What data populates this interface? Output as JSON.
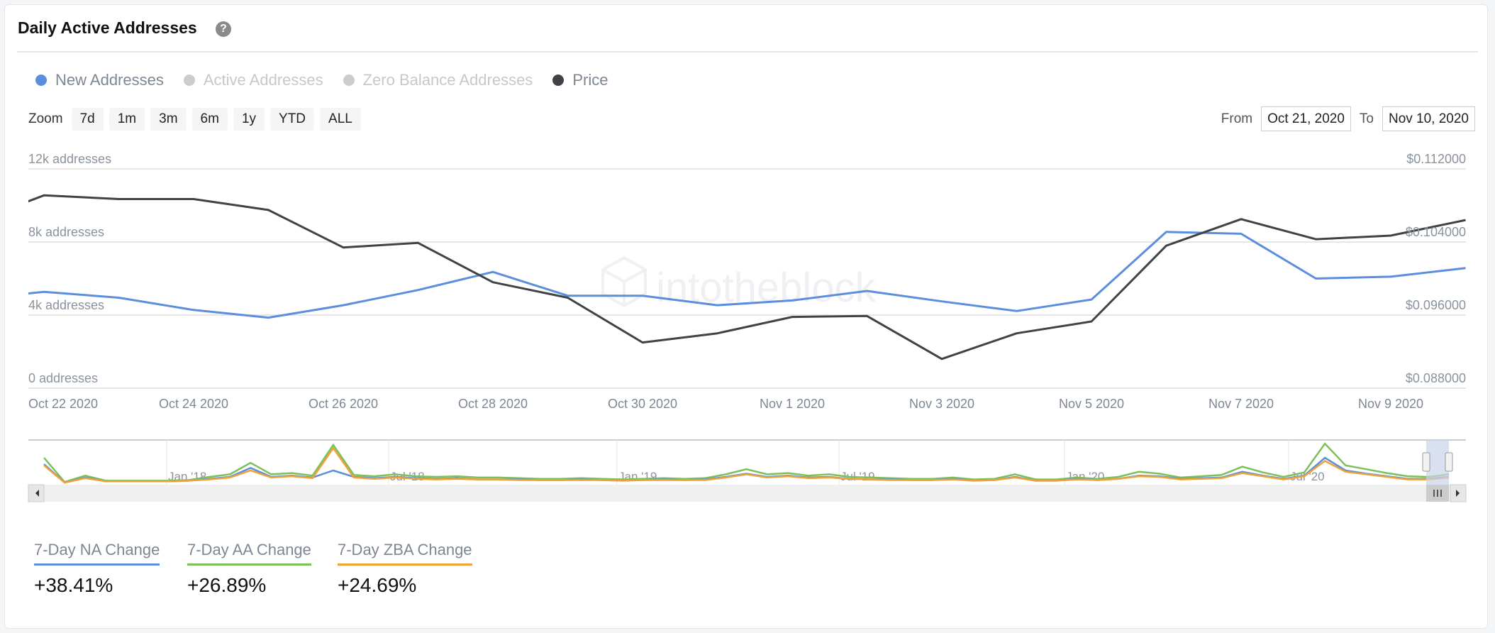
{
  "header": {
    "title": "Daily Active Addresses",
    "help_icon": "question-circle-icon"
  },
  "legend": [
    {
      "label": "New Addresses",
      "color": "#5b8fde",
      "active": true
    },
    {
      "label": "Active Addresses",
      "color": "#cccccc",
      "active": false
    },
    {
      "label": "Zero Balance Addresses",
      "color": "#cccccc",
      "active": false
    },
    {
      "label": "Price",
      "color": "#3f4246",
      "active": true
    }
  ],
  "zoom": {
    "label": "Zoom",
    "buttons": [
      "7d",
      "1m",
      "3m",
      "6m",
      "1y",
      "YTD",
      "ALL"
    ]
  },
  "range": {
    "from_label": "From",
    "from_value": "Oct 21, 2020",
    "to_label": "To",
    "to_value": "Nov 10, 2020"
  },
  "watermark": "intotheblock",
  "chart_data": {
    "type": "line",
    "x": [
      "Oct 21 2020",
      "Oct 22 2020",
      "Oct 23 2020",
      "Oct 24 2020",
      "Oct 25 2020",
      "Oct 26 2020",
      "Oct 27 2020",
      "Oct 28 2020",
      "Oct 29 2020",
      "Oct 30 2020",
      "Oct 31 2020",
      "Nov 1 2020",
      "Nov 2 2020",
      "Nov 3 2020",
      "Nov 4 2020",
      "Nov 5 2020",
      "Nov 6 2020",
      "Nov 7 2020",
      "Nov 8 2020",
      "Nov 9 2020",
      "Nov 10 2020"
    ],
    "x_tick_labels": [
      {
        "i": 1,
        "label": "Oct 22 2020"
      },
      {
        "i": 3,
        "label": "Oct 24 2020"
      },
      {
        "i": 5,
        "label": "Oct 26 2020"
      },
      {
        "i": 7,
        "label": "Oct 28 2020"
      },
      {
        "i": 9,
        "label": "Oct 30 2020"
      },
      {
        "i": 11,
        "label": "Nov 1 2020"
      },
      {
        "i": 13,
        "label": "Nov 3 2020"
      },
      {
        "i": 15,
        "label": "Nov 5 2020"
      },
      {
        "i": 17,
        "label": "Nov 7 2020"
      },
      {
        "i": 19,
        "label": "Nov 9 2020"
      }
    ],
    "y_left": {
      "ylim": [
        0,
        12000
      ],
      "ticks": [
        {
          "v": 12000,
          "label": "12k addresses"
        },
        {
          "v": 8000,
          "label": "8k addresses"
        },
        {
          "v": 4000,
          "label": "4k addresses"
        },
        {
          "v": 0,
          "label": "0 addresses"
        }
      ]
    },
    "y_right": {
      "ylim": [
        0.088,
        0.112
      ],
      "ticks": [
        {
          "v": 0.112,
          "label": "$0.112000"
        },
        {
          "v": 0.104,
          "label": "$0.104000"
        },
        {
          "v": 0.096,
          "label": "$0.096000"
        },
        {
          "v": 0.088,
          "label": "$0.088000"
        }
      ]
    },
    "grid": true,
    "series": [
      {
        "name": "New Addresses",
        "axis": "left",
        "color": "#5b8fde",
        "values": [
          4850,
          5270,
          4950,
          4280,
          3860,
          4540,
          5370,
          6360,
          5060,
          5060,
          4540,
          4800,
          5320,
          4750,
          4220,
          4850,
          8550,
          8450,
          6000,
          6100,
          6570
        ]
      },
      {
        "name": "Price",
        "axis": "right",
        "color": "#3f4246",
        "values": [
          0.106,
          0.1091,
          0.1087,
          0.1087,
          0.1075,
          0.1034,
          0.1039,
          0.0996,
          0.0979,
          0.093,
          0.094,
          0.0958,
          0.0959,
          0.0912,
          0.094,
          0.0953,
          0.1036,
          0.1065,
          0.1043,
          0.1047,
          0.1064
        ]
      }
    ],
    "navigator": {
      "tick_labels": [
        "Jan '18",
        "Jul '18",
        "Jan '19",
        "Jul '19",
        "Jan '20",
        "Jul '20"
      ],
      "series": [
        {
          "name": "Active Addresses",
          "color": "#7cc05a",
          "values": [
            40,
            2,
            12,
            4,
            4,
            4,
            4,
            5,
            10,
            14,
            32,
            14,
            16,
            12,
            60,
            13,
            11,
            14,
            11,
            10,
            11,
            9,
            9,
            8,
            7,
            7,
            8,
            7,
            6,
            7,
            8,
            7,
            8,
            14,
            22,
            14,
            16,
            12,
            14,
            10,
            9,
            8,
            7,
            7,
            9,
            6,
            7,
            14,
            6,
            6,
            9,
            7,
            10,
            18,
            15,
            9,
            11,
            13,
            26,
            17,
            10,
            17,
            62,
            28,
            22,
            16,
            11,
            10,
            14
          ]
        },
        {
          "name": "New Addresses",
          "color": "#5b8fde",
          "values": [
            30,
            1,
            9,
            3,
            3,
            3,
            3,
            4,
            7,
            10,
            24,
            10,
            12,
            9,
            20,
            10,
            8,
            10,
            8,
            7,
            8,
            6,
            6,
            6,
            5,
            5,
            6,
            5,
            4,
            5,
            6,
            5,
            6,
            10,
            15,
            10,
            12,
            9,
            10,
            7,
            6,
            6,
            5,
            5,
            7,
            4,
            5,
            10,
            4,
            4,
            7,
            5,
            7,
            12,
            11,
            7,
            8,
            9,
            18,
            12,
            7,
            12,
            40,
            20,
            15,
            11,
            7,
            7,
            10
          ]
        },
        {
          "name": "Zero Balance Addresses",
          "color": "#f0a23a",
          "values": [
            28,
            1,
            8,
            3,
            3,
            3,
            3,
            4,
            6,
            9,
            20,
            9,
            11,
            8,
            55,
            9,
            7,
            9,
            7,
            6,
            7,
            6,
            6,
            5,
            5,
            5,
            5,
            5,
            4,
            5,
            5,
            5,
            5,
            9,
            14,
            9,
            11,
            8,
            9,
            7,
            6,
            5,
            5,
            5,
            6,
            4,
            5,
            9,
            4,
            4,
            6,
            5,
            7,
            11,
            10,
            6,
            7,
            8,
            16,
            11,
            6,
            11,
            35,
            18,
            14,
            10,
            6,
            6,
            9
          ]
        }
      ]
    }
  },
  "stats": [
    {
      "label": "7-Day NA Change",
      "value": "+38.41%",
      "color": "#5b8fde"
    },
    {
      "label": "7-Day AA Change",
      "value": "+26.89%",
      "color": "#7cc05a"
    },
    {
      "label": "7-Day ZBA Change",
      "value": "+24.69%",
      "color": "#f0a23a"
    }
  ]
}
